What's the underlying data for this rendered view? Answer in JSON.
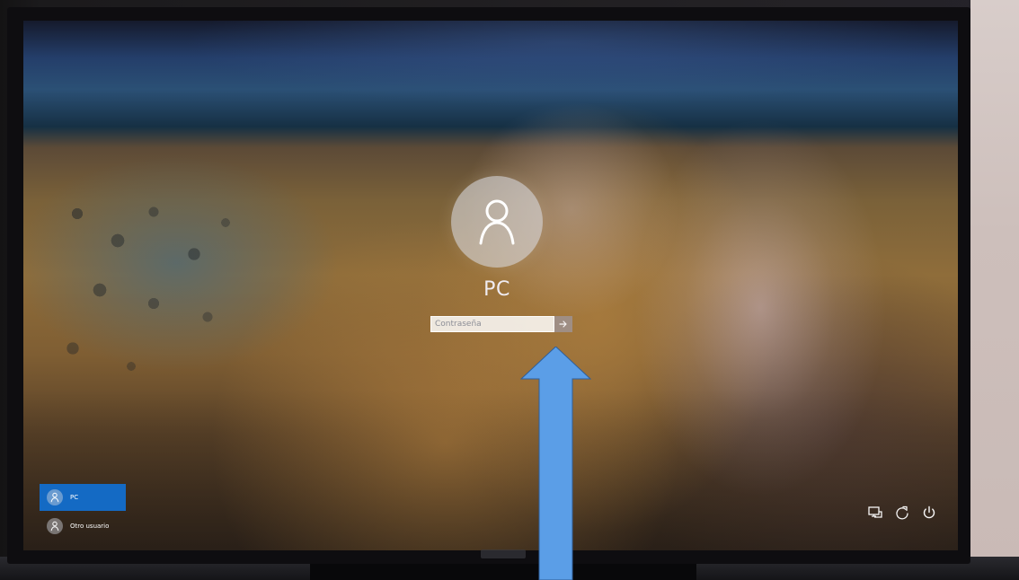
{
  "login_screen": {
    "user_name": "PC",
    "password_placeholder": "Contraseña",
    "submit_icon": "arrow-right-icon"
  },
  "accounts": [
    {
      "label": "PC",
      "selected": true
    },
    {
      "label": "Otro usuario",
      "selected": false
    }
  ],
  "system_icons": {
    "network": "network-icon",
    "accessibility": "accessibility-icon",
    "power": "power-icon"
  },
  "colors": {
    "selected_account": "#146ac4",
    "annotation_arrow": "#5b9ee7"
  }
}
